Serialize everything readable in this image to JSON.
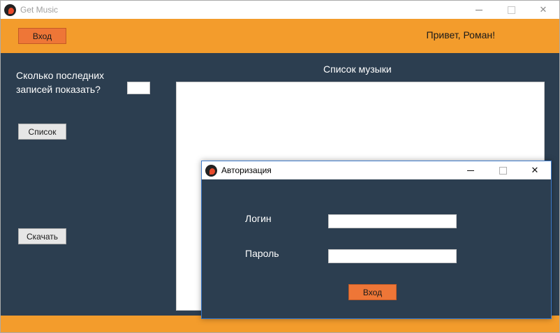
{
  "app": {
    "title": "Get Music",
    "login_button": "Вход",
    "greeting": "Привет, Роман!",
    "records_label_line1": "Сколько последних",
    "records_label_line2": "записей показать?",
    "records_input_value": "",
    "list_button": "Список",
    "download_button": "Скачать",
    "music_list_title": "Список музыки",
    "music_list_items": []
  },
  "dialog": {
    "title": "Авторизация",
    "login_label": "Логин",
    "login_value": "",
    "password_label": "Пароль",
    "password_value": "",
    "submit_button": "Вход"
  },
  "window_controls": {
    "minimize": "—",
    "maximize": "□",
    "close": "✕"
  },
  "colors": {
    "accent_orange": "#f39c2c",
    "button_orange": "#ee7637",
    "background": "#2c3e50"
  }
}
